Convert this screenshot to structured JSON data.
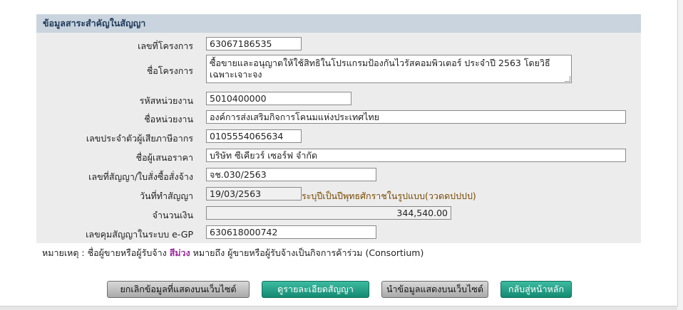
{
  "panel": {
    "header": "ข้อมูลสาระสำคัญในสัญญา"
  },
  "fields": {
    "project_no": {
      "label": "เลขที่โครงการ",
      "value": "63067186535"
    },
    "project_name": {
      "label": "ชื่อโครงการ",
      "value": "ซื้อขายและอนุญาตให้ใช้สิทธิในโปรแกรมป้องกันไวรัสคอมพิวเตอร์ ประจำปี 2563 โดยวิธีเฉพาะเจาะจง"
    },
    "agency_code": {
      "label": "รหัสหน่วยงาน",
      "value": "5010400000"
    },
    "agency_name": {
      "label": "ชื่อหน่วยงาน",
      "value": "องค์การส่งเสริมกิจการโคนมแห่งประเทศไทย"
    },
    "tax_id": {
      "label": "เลขประจำตัวผู้เสียภาษีอากร",
      "value": "0105554065634"
    },
    "bidder": {
      "label": "ชื่อผู้เสนอราคา",
      "value": "บริษัท ซีเคียวร์ เซอร์ฟ จำกัด"
    },
    "contract_no": {
      "label": "เลขที่สัญญา/ใบสั่งซื้อสั่งจ้าง",
      "value": "จช.030/2563"
    },
    "contract_date": {
      "label": "วันที่ทำสัญญา",
      "value": "19/03/2563",
      "hint": "ระบุปีเป็นปีพุทธศักราชในรูปแบบ(ววดดปปปป)"
    },
    "amount": {
      "label": "จำนวนเงิน",
      "value": "344,540.00"
    },
    "egp_no": {
      "label": "เลขคุมสัญญาในระบบ e-GP",
      "value": "630618000742"
    }
  },
  "note": {
    "prefix": "หมายเหตุ : ชื่อผู้ขายหรือผู้รับจ้าง",
    "highlight": "สีม่วง",
    "suffix": "หมายถึง ผู้ขายหรือผู้รับจ้างเป็นกิจการค้าร่วม (Consortium)"
  },
  "buttons": {
    "unpublish": "ยกเลิกข้อมูลที่แสดงบนเว็บไซต์",
    "detail": "ดูรายละเอียดสัญญา",
    "publish": "นำข้อมูลแสดงบนเว็บไซต์",
    "home": "กลับสู่หน้าหลัก"
  },
  "colors": {
    "header_bg": "#c9d4de",
    "panel_bg": "#ececec",
    "teal": "#138a72",
    "purple": "#9b2a9b"
  }
}
